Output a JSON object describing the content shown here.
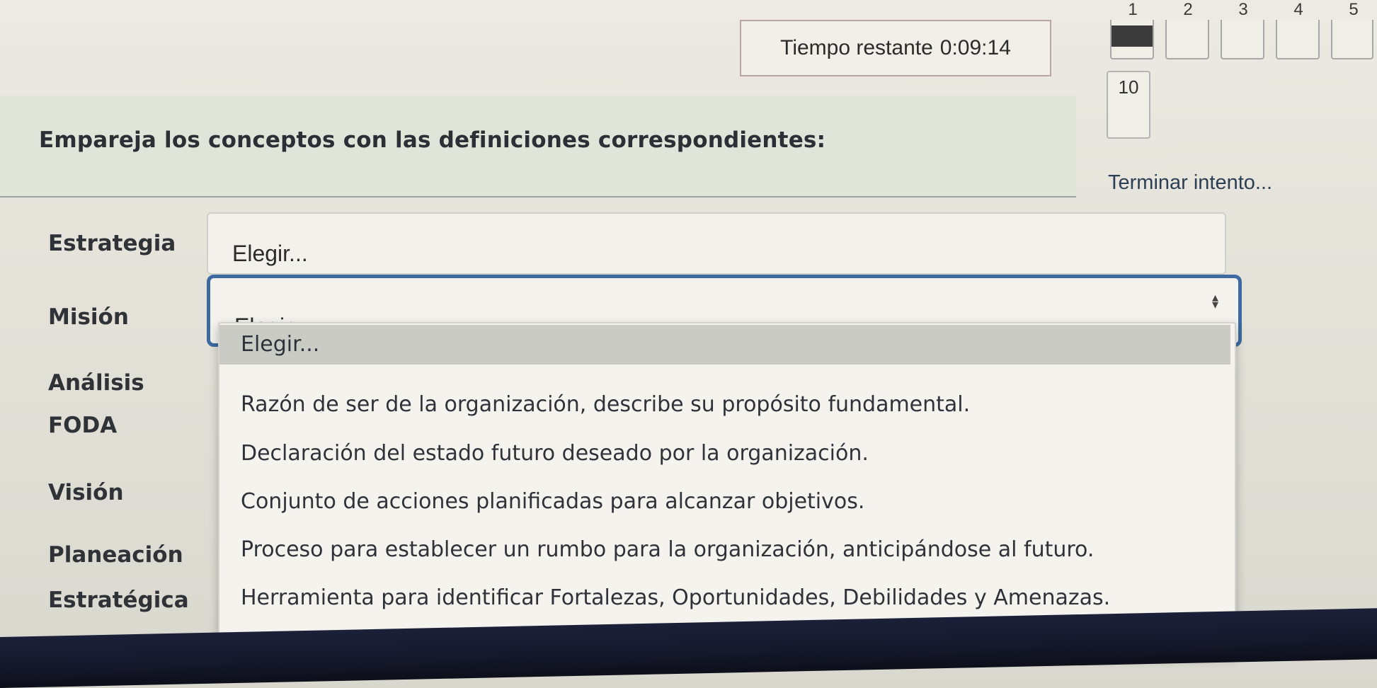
{
  "timer": {
    "label": "Tiempo restante",
    "value": "0:09:14"
  },
  "quiz_nav": {
    "numbers": [
      "1",
      "2",
      "3",
      "4",
      "5"
    ],
    "current": "10",
    "finish_label": "Terminar intento..."
  },
  "question": {
    "text": "Empareja los conceptos con las definiciones correspondientes:"
  },
  "concepts": [
    "Estrategia",
    "Misión",
    "Análisis",
    "FODA",
    "Visión",
    "Planeación",
    "Estratégica"
  ],
  "selects": [
    "Elegir...",
    "Elegir..."
  ],
  "dropdown": {
    "options": [
      "Elegir...",
      "Razón de ser de la organización, describe su propósito fundamental.",
      "Declaración del estado futuro deseado por la organización.",
      "Conjunto de acciones planificadas para alcanzar objetivos.",
      "Proceso para establecer un rumbo para la organización, anticipándose al futuro.",
      "Herramienta para identificar Fortalezas, Oportunidades, Debilidades y Amenazas."
    ]
  },
  "colors": {
    "focus_border": "#3d6aa0",
    "question_bg": "#dfe5d8",
    "highlight": "#cbcbc5"
  }
}
